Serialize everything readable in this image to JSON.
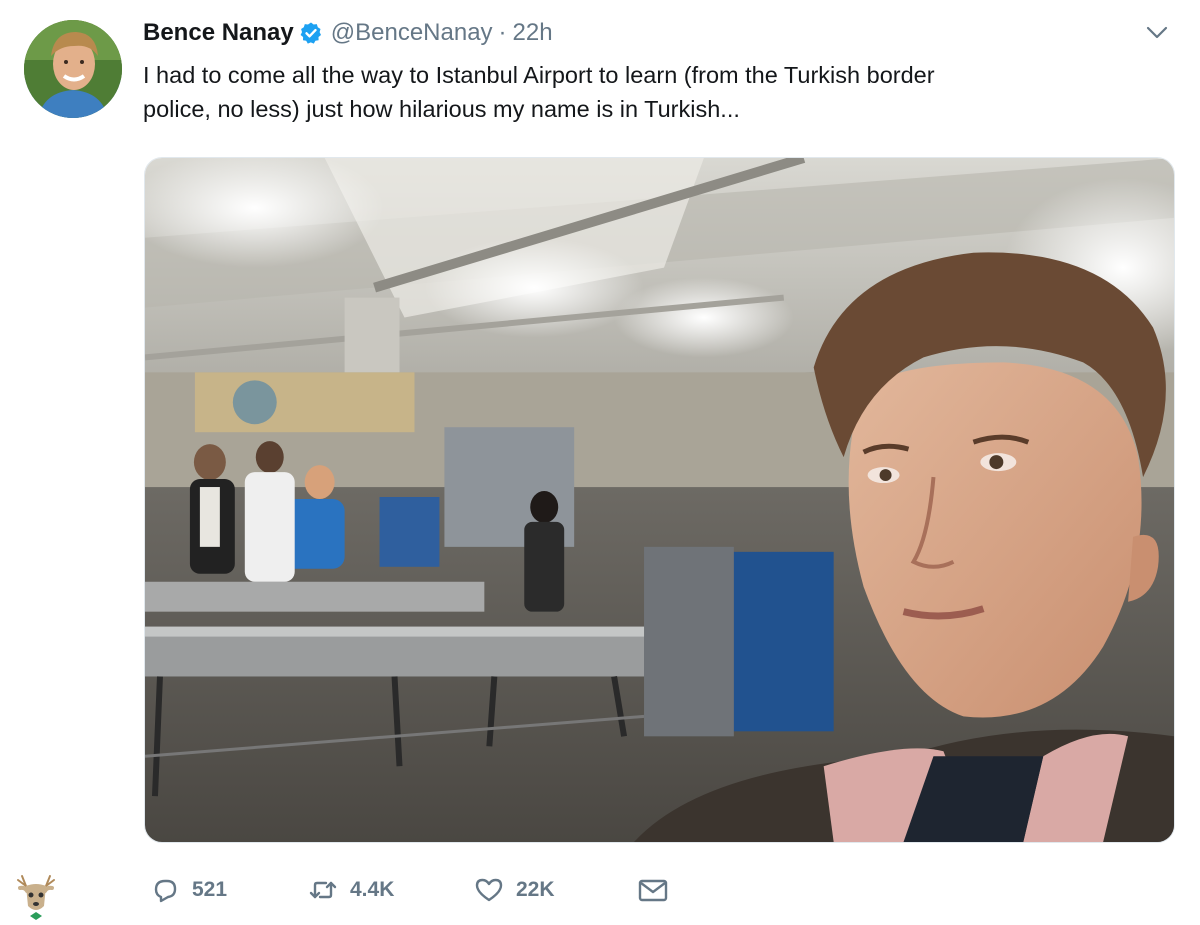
{
  "tweet": {
    "display_name": "Bence Nanay",
    "handle": "@BenceNanay",
    "separator": "·",
    "time": "22h",
    "text": "I had to come all the way to Istanbul Airport to learn (from the Turkish border\npolice, no less) just how hilarious my name is in Turkish..."
  },
  "actions": {
    "reply_count": "521",
    "retweet_count": "4.4K",
    "like_count": "22K"
  },
  "icons": {
    "verified": "verified-badge-icon",
    "caret": "chevron-down-icon",
    "reply": "reply-bubble-icon",
    "retweet": "retweet-icon",
    "like": "heart-icon",
    "dm": "envelope-icon",
    "corner": "deer-icon"
  },
  "colors": {
    "verified_blue": "#1da1f2",
    "muted_gray": "#657786",
    "text": "#14171a"
  }
}
